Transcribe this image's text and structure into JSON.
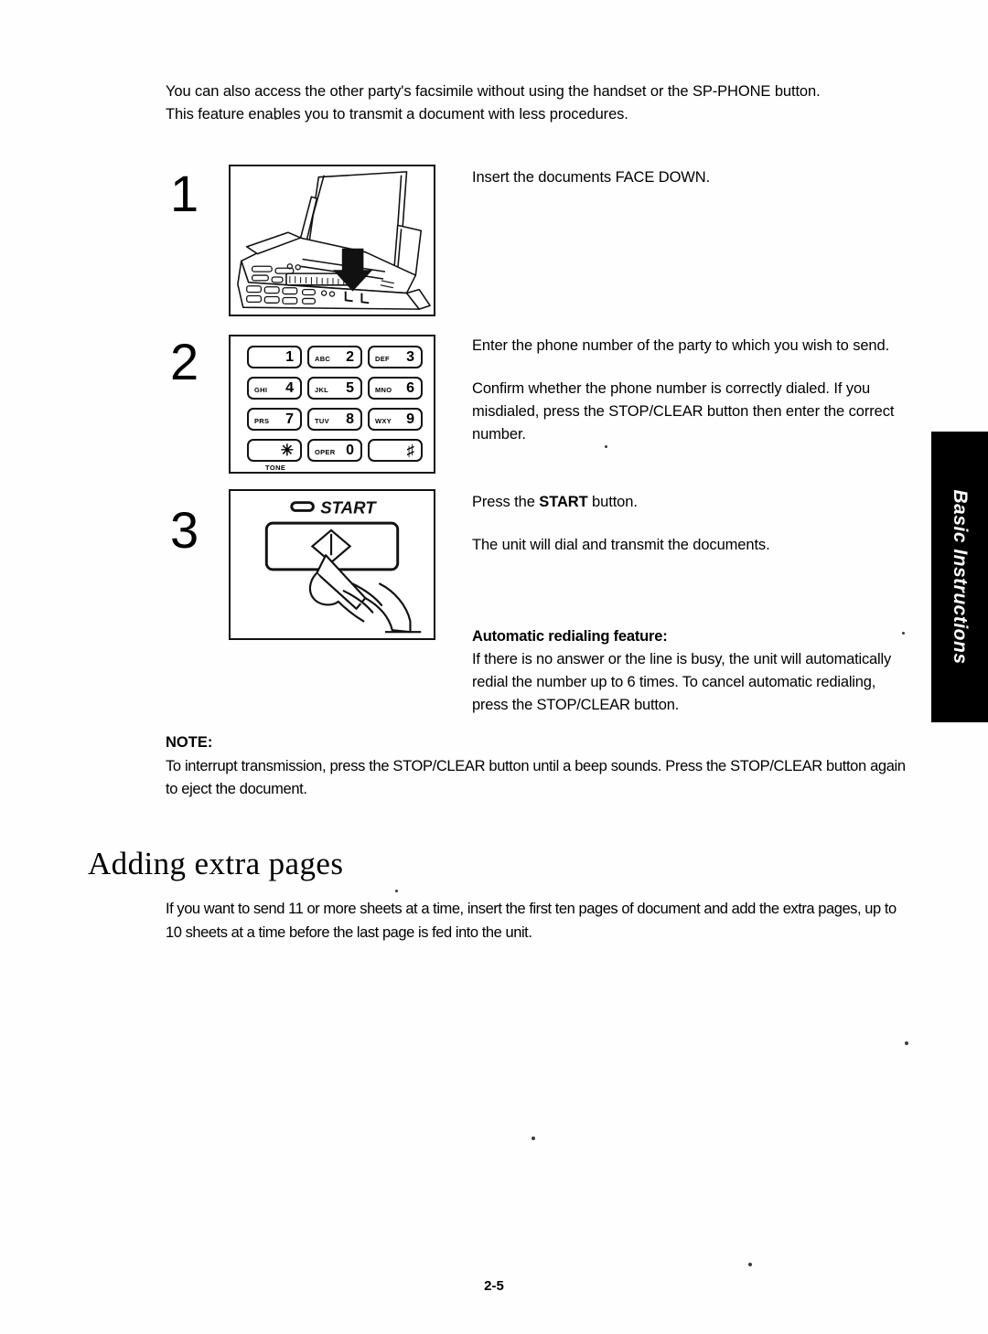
{
  "intro": {
    "line1": "You can also access the other party's facsimile without using the handset or the SP-PHONE",
    "line2": "button.",
    "line3": "This feature enables you to transmit a document with less procedures."
  },
  "steps": [
    {
      "number": "1",
      "illustration": "fax-machine-load-document",
      "text": "Insert the documents FACE DOWN."
    },
    {
      "number": "2",
      "illustration": "dial-keypad",
      "paragraph1": "Enter the phone number of the party to which you wish to send.",
      "paragraph2": "Confirm whether the phone number is correctly dialed. If you misdialed, press the STOP/CLEAR button then enter the correct number."
    },
    {
      "number": "3",
      "illustration": "start-button-press",
      "paragraph1_before": "Press the ",
      "paragraph1_bold": "START",
      "paragraph1_after": " button.",
      "paragraph2": "The unit will dial and transmit the documents."
    }
  ],
  "keypad": {
    "start_label": "START",
    "tone_label": "TONE",
    "keys": [
      {
        "letters": "",
        "digit": "1"
      },
      {
        "letters": "ABC",
        "digit": "2"
      },
      {
        "letters": "DEF",
        "digit": "3"
      },
      {
        "letters": "GHI",
        "digit": "4"
      },
      {
        "letters": "JKL",
        "digit": "5"
      },
      {
        "letters": "MNO",
        "digit": "6"
      },
      {
        "letters": "PRS",
        "digit": "7"
      },
      {
        "letters": "TUV",
        "digit": "8"
      },
      {
        "letters": "WXY",
        "digit": "9"
      },
      {
        "letters": "",
        "digit": "✳"
      },
      {
        "letters": "OPER",
        "digit": "0"
      },
      {
        "letters": "",
        "digit": "♯"
      }
    ]
  },
  "redialing": {
    "heading": "Automatic redialing feature:",
    "body": "If there is no answer or the line is busy, the unit will automatically redial the number up to 6 times. To cancel automatic redialing, press the STOP/CLEAR button."
  },
  "note": {
    "heading": "NOTE:",
    "body": "To interrupt transmission, press the STOP/CLEAR button until a beep sounds. Press the STOP/CLEAR button again to eject the document."
  },
  "section": {
    "heading": "Adding extra pages",
    "body": "If you want to send 11 or more sheets at a time, insert the first ten pages of document and add the extra pages, up to 10 sheets at a time before the last page is fed into the unit."
  },
  "side_tab": {
    "label": "Basic Instructions"
  },
  "footer": {
    "page_number": "2-5"
  }
}
